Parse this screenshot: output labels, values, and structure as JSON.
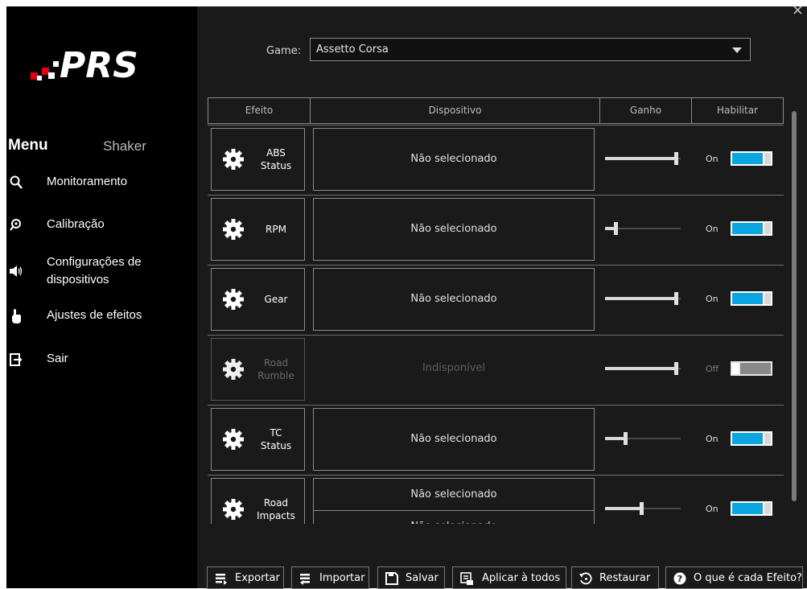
{
  "sidebar": {
    "logo_text": "PRS",
    "menu_title": "Menu",
    "menu_sub": "Shaker",
    "items": [
      {
        "label": "Monitoramento"
      },
      {
        "label": "Calibração"
      },
      {
        "label": "Configurações de dispositivos"
      },
      {
        "label": "Ajustes de efeitos"
      },
      {
        "label": "Sair"
      }
    ]
  },
  "main": {
    "close_label": "×",
    "game_label": "Game:",
    "game_value": "Assetto Corsa",
    "columns": [
      "Efeito",
      "Dispositivo",
      "Ganho",
      "Habilitar"
    ],
    "rows": [
      {
        "effect": "ABS\nStatus",
        "device": "Não selecionado",
        "gain_pct": 95,
        "enable_label": "On",
        "enabled": true
      },
      {
        "effect": "RPM",
        "device": "Não selecionado",
        "gain_pct": 12,
        "enable_label": "On",
        "enabled": true
      },
      {
        "effect": "Gear",
        "device": "Não selecionado",
        "gain_pct": 95,
        "enable_label": "On",
        "enabled": true
      },
      {
        "effect": "Road\nRumble",
        "device": "Indisponível",
        "gain_pct": 95,
        "enable_label": "Off",
        "enabled": false
      },
      {
        "effect": "TC\nStatus",
        "device": "Não selecionado",
        "gain_pct": 25,
        "enable_label": "On",
        "enabled": true
      },
      {
        "effect": "Road\nImpacts",
        "device": "Não selecionado",
        "device_2": "Não selecionado",
        "gain_pct": 48,
        "enable_label": "On",
        "enabled": true
      }
    ]
  },
  "toolbar": {
    "export": "Exportar",
    "import": "Importar",
    "save": "Salvar",
    "apply_all": "Aplicar à todos",
    "restore": "Restaurar",
    "help": "O que é cada Efeito?"
  },
  "colors": {
    "accent": "#0aa6df",
    "logo_red": "#e3000f",
    "background": "#1a1a1a",
    "sidebar": "#000000"
  }
}
